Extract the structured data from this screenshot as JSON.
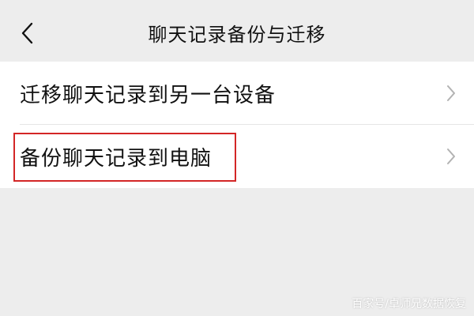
{
  "header": {
    "title": "聊天记录备份与迁移",
    "back_icon": "chevron-left-icon"
  },
  "list": {
    "items": [
      {
        "label": "迁移聊天记录到另一台设备",
        "icon": "chevron-right-icon"
      },
      {
        "label": "备份聊天记录到电脑",
        "icon": "chevron-right-icon",
        "highlighted": true
      }
    ]
  },
  "watermark": {
    "text": "百家号/卓师兄数据恢复"
  },
  "colors": {
    "page_background": "#ededed",
    "list_background": "#ffffff",
    "text": "#111111",
    "chevron": "#b2b2b2",
    "highlight_border": "#d32626"
  }
}
